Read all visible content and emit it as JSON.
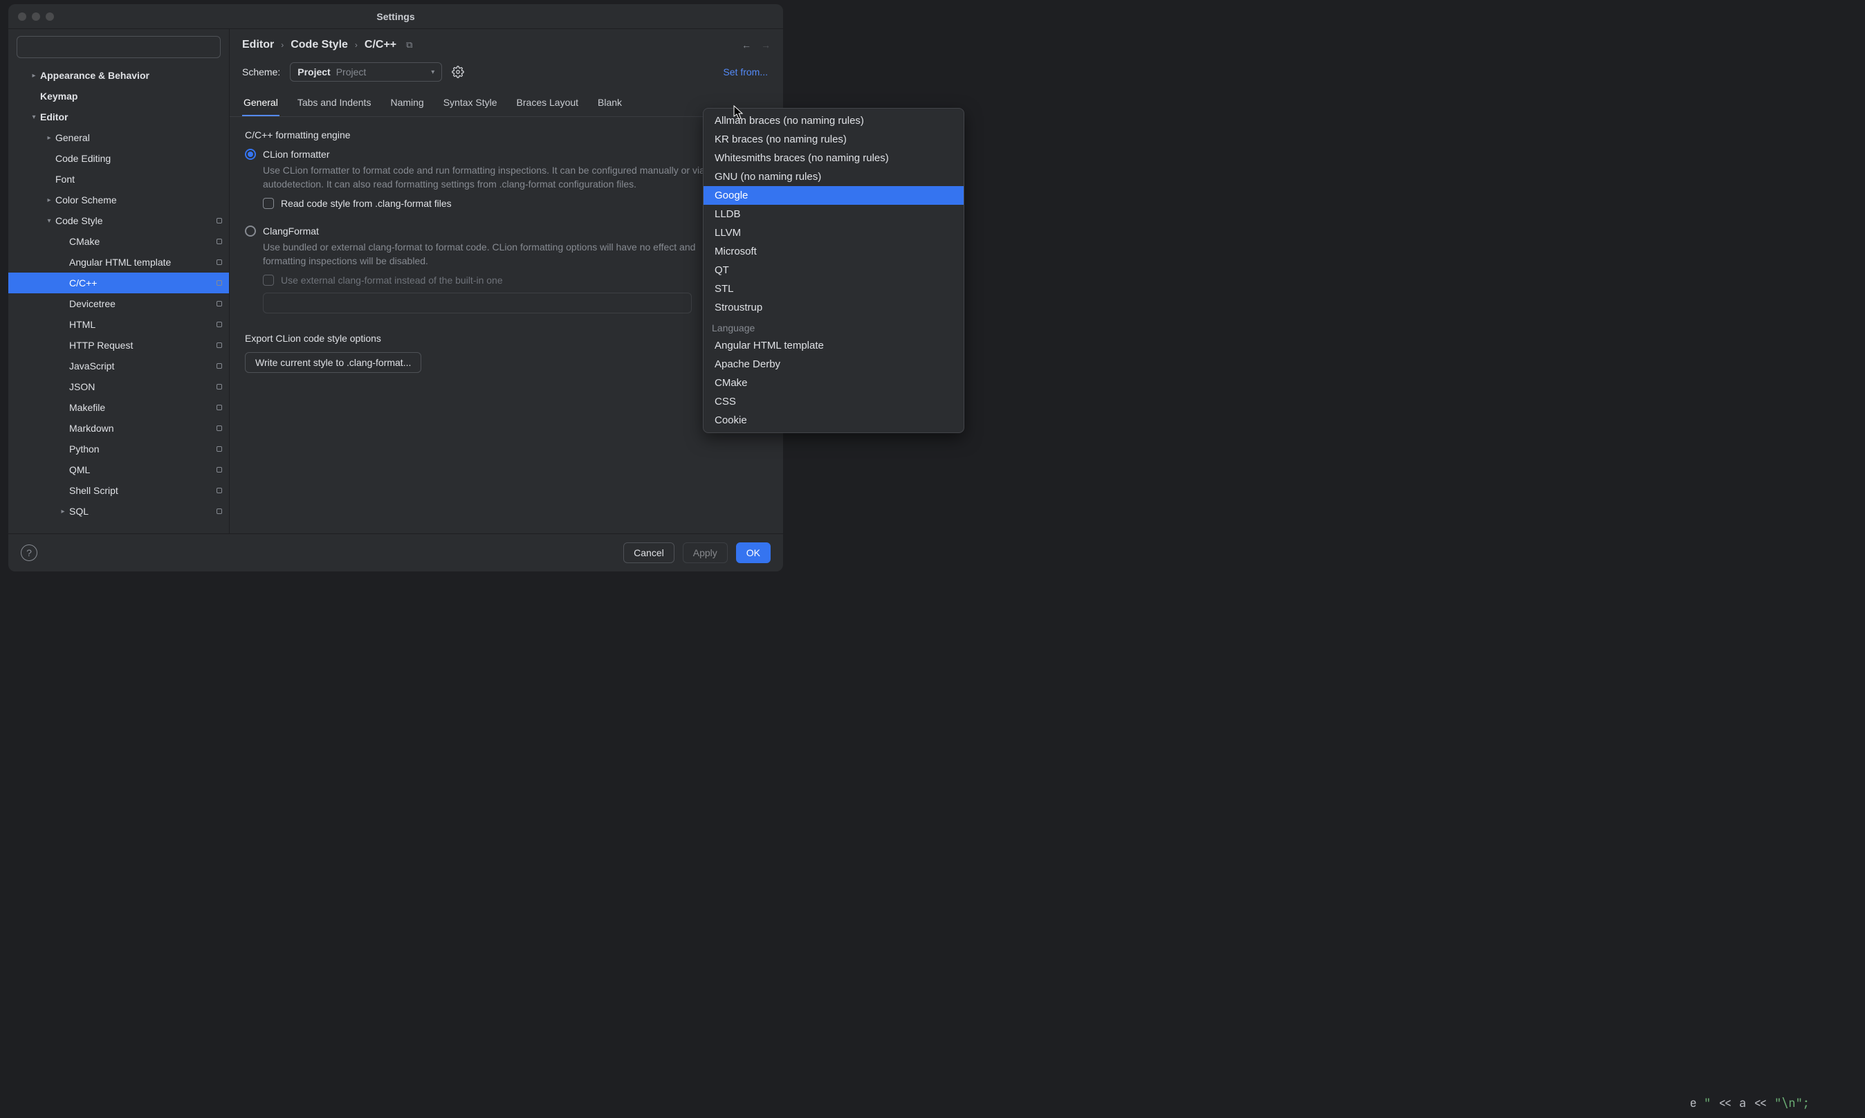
{
  "window": {
    "title": "Settings"
  },
  "search": {
    "placeholder": ""
  },
  "tree": {
    "items": [
      {
        "label": "Appearance & Behavior",
        "depth": 1,
        "chev": "right",
        "bold": true,
        "badge": false
      },
      {
        "label": "Keymap",
        "depth": 1,
        "chev": "",
        "bold": true,
        "badge": false
      },
      {
        "label": "Editor",
        "depth": 1,
        "chev": "down",
        "bold": true,
        "badge": false
      },
      {
        "label": "General",
        "depth": 2,
        "chev": "right",
        "bold": false,
        "badge": false
      },
      {
        "label": "Code Editing",
        "depth": 2,
        "chev": "",
        "bold": false,
        "badge": false
      },
      {
        "label": "Font",
        "depth": 2,
        "chev": "",
        "bold": false,
        "badge": false
      },
      {
        "label": "Color Scheme",
        "depth": 2,
        "chev": "right",
        "bold": false,
        "badge": false
      },
      {
        "label": "Code Style",
        "depth": 2,
        "chev": "down",
        "bold": false,
        "badge": true
      },
      {
        "label": "CMake",
        "depth": 3,
        "chev": "",
        "bold": false,
        "badge": true
      },
      {
        "label": "Angular HTML template",
        "depth": 3,
        "chev": "",
        "bold": false,
        "badge": true
      },
      {
        "label": "C/C++",
        "depth": 3,
        "chev": "",
        "bold": false,
        "badge": true,
        "selected": true
      },
      {
        "label": "Devicetree",
        "depth": 3,
        "chev": "",
        "bold": false,
        "badge": true
      },
      {
        "label": "HTML",
        "depth": 3,
        "chev": "",
        "bold": false,
        "badge": true
      },
      {
        "label": "HTTP Request",
        "depth": 3,
        "chev": "",
        "bold": false,
        "badge": true
      },
      {
        "label": "JavaScript",
        "depth": 3,
        "chev": "",
        "bold": false,
        "badge": true
      },
      {
        "label": "JSON",
        "depth": 3,
        "chev": "",
        "bold": false,
        "badge": true
      },
      {
        "label": "Makefile",
        "depth": 3,
        "chev": "",
        "bold": false,
        "badge": true
      },
      {
        "label": "Markdown",
        "depth": 3,
        "chev": "",
        "bold": false,
        "badge": true
      },
      {
        "label": "Python",
        "depth": 3,
        "chev": "",
        "bold": false,
        "badge": true
      },
      {
        "label": "QML",
        "depth": 3,
        "chev": "",
        "bold": false,
        "badge": true
      },
      {
        "label": "Shell Script",
        "depth": 3,
        "chev": "",
        "bold": false,
        "badge": true
      },
      {
        "label": "SQL",
        "depth": 3,
        "chev": "right",
        "bold": false,
        "badge": true
      }
    ]
  },
  "breadcrumb": [
    "Editor",
    "Code Style",
    "C/C++"
  ],
  "scheme": {
    "label": "Scheme:",
    "name": "Project",
    "sub": "Project",
    "set_from": "Set from..."
  },
  "tabs": [
    "General",
    "Tabs and Indents",
    "Naming",
    "Syntax Style",
    "Braces Layout",
    "Blank"
  ],
  "content": {
    "engine_title": "C/C++ formatting engine",
    "clion_radio": "CLion formatter",
    "clion_desc": "Use CLion formatter to format code and run formatting inspections. It can be configured manually or via autodetection. It can also read formatting settings from .clang-format configuration files.",
    "read_clang_chk": "Read code style from .clang-format files",
    "clangformat_radio": "ClangFormat",
    "clangformat_desc": "Use bundled or external clang-format to format code. CLion formatting options will have no effect and formatting inspections will be disabled.",
    "external_chk": "Use external clang-format instead of the built-in one",
    "export_title": "Export CLion code style options",
    "write_btn": "Write current style to .clang-format..."
  },
  "footer": {
    "cancel": "Cancel",
    "apply": "Apply",
    "ok": "OK"
  },
  "popup": {
    "items1": [
      "Allman braces (no naming rules)",
      "KR braces (no naming rules)",
      "Whitesmiths braces (no naming rules)",
      "GNU (no naming rules)",
      "Google",
      "LLDB",
      "LLVM",
      "Microsoft",
      "QT",
      "STL",
      "Stroustrup"
    ],
    "selected1": "Google",
    "header2": "Language",
    "items2": [
      "Angular HTML template",
      "Apache Derby",
      "CMake",
      "CSS",
      "Cookie"
    ]
  },
  "bg_code": {
    "text_prefix": "e ",
    "quote": "\"",
    "op": " << ",
    "var": "a",
    "tail": "\"\\n\";"
  }
}
